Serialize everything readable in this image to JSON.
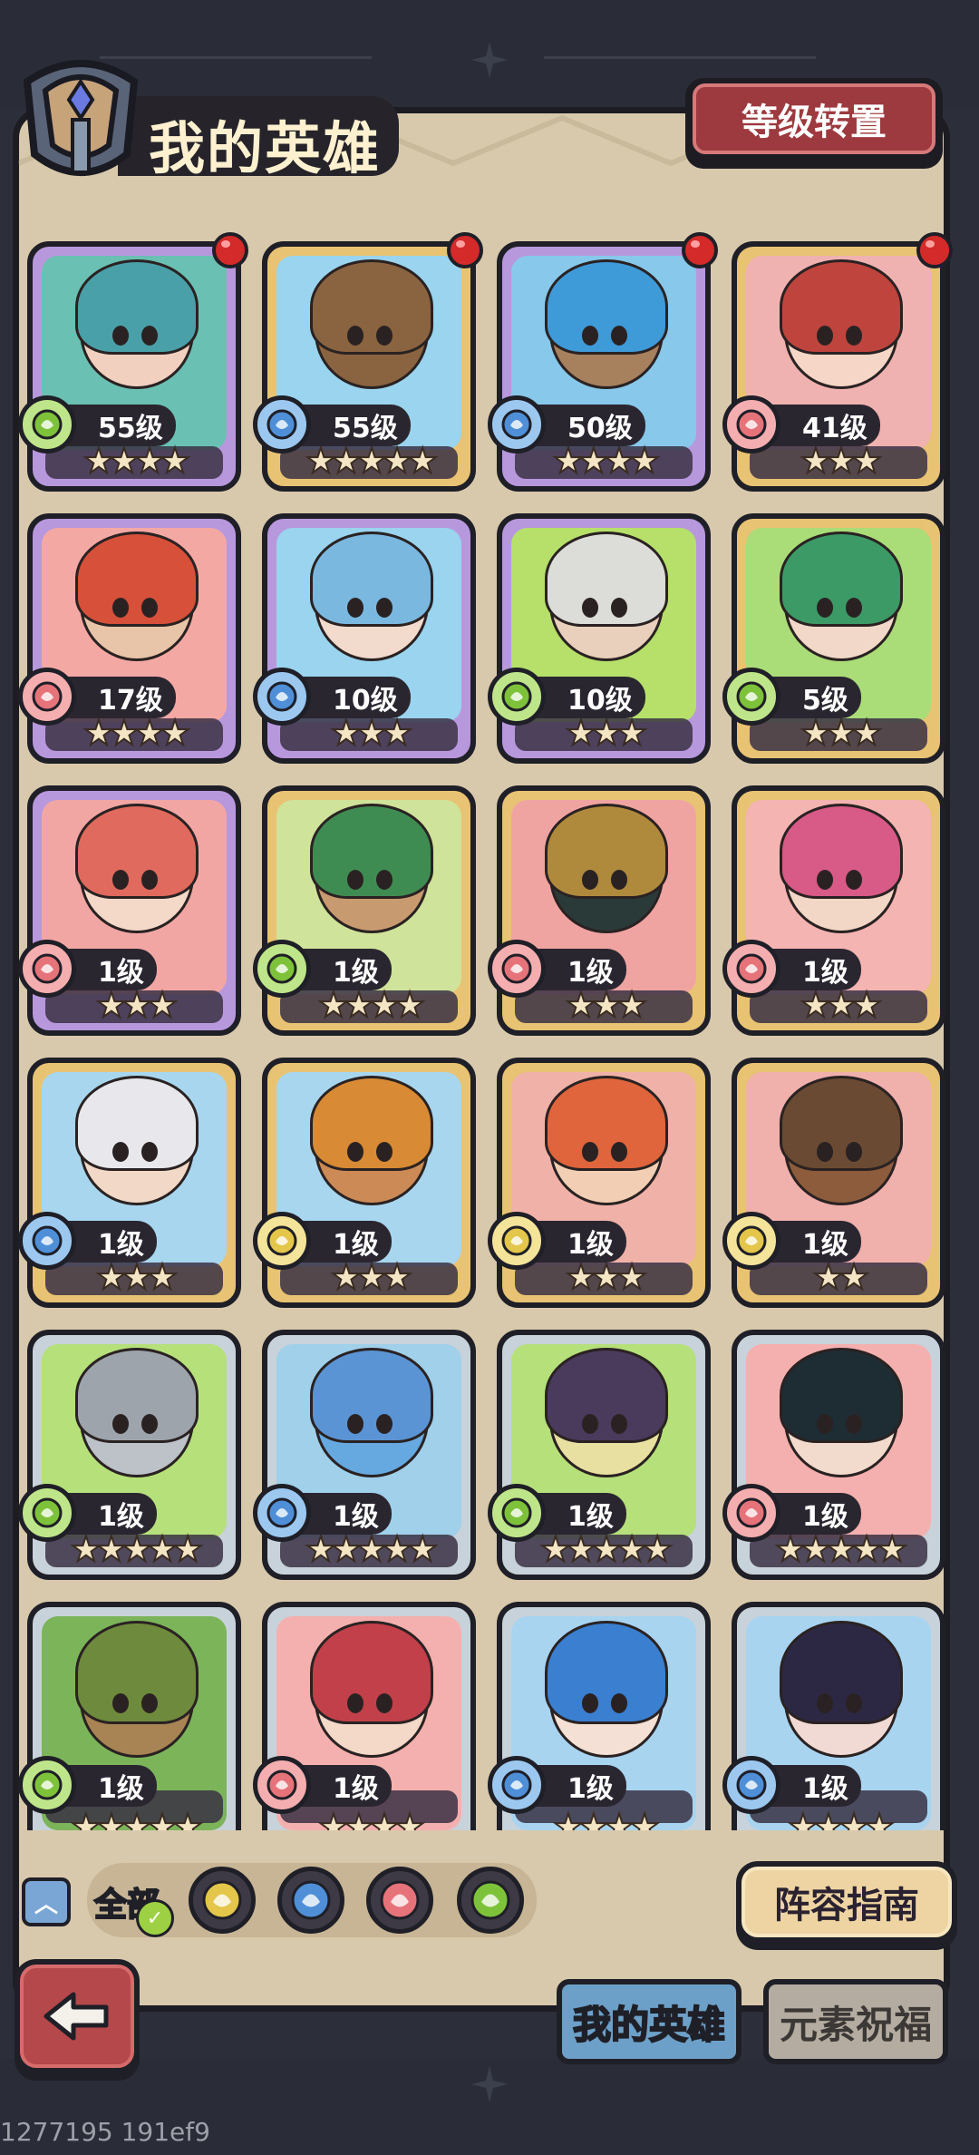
{
  "header": {
    "title": "我的英雄",
    "level_transfer_label": "等级转置"
  },
  "colors": {
    "fire": "#e66a72",
    "water": "#4a8fd6",
    "wind": "#7fc43a",
    "earth": "#e2c74a",
    "frame_purple": "#b898dd",
    "frame_gold": "#e8c373",
    "frame_silver": "#c8d2da"
  },
  "heroes": [
    {
      "level": "55级",
      "element": "wind-icon",
      "stars": "★★★★",
      "frame": "purple",
      "bg": "#6ac0b2",
      "hair": "#4aa0a8",
      "skin": "#f2d0c0",
      "dot": true
    },
    {
      "level": "55级",
      "element": "water-icon",
      "stars": "★★★★★",
      "frame": "gold",
      "bg": "#9ad4ee",
      "hair": "#8a6440",
      "skin": "#8a6440",
      "dot": true
    },
    {
      "level": "50级",
      "element": "water-icon",
      "stars": "★★★★",
      "frame": "purple",
      "bg": "#88c8ea",
      "hair": "#3f9ad8",
      "skin": "#a7805e",
      "dot": true
    },
    {
      "level": "41级",
      "element": "fire-icon",
      "stars": "★★★",
      "frame": "gold",
      "bg": "#f0b2b0",
      "hair": "#c0443e",
      "skin": "#f6d6c6",
      "dot": true
    },
    {
      "level": "17级",
      "element": "fire-icon",
      "stars": "★★★★",
      "frame": "purple",
      "bg": "#f4a8a4",
      "hair": "#d6503a",
      "skin": "#e8c4a8",
      "dot": false
    },
    {
      "level": "10级",
      "element": "water-icon",
      "stars": "★★★",
      "frame": "purple",
      "bg": "#9ad4ee",
      "hair": "#7ab8e0",
      "skin": "#f2dacc",
      "dot": false
    },
    {
      "level": "10级",
      "element": "wind-icon",
      "stars": "★★★",
      "frame": "purple",
      "bg": "#b6e06a",
      "hair": "#dcdcd8",
      "skin": "#e8d0bc",
      "dot": false
    },
    {
      "level": "5级",
      "element": "wind-icon",
      "stars": "★★★",
      "frame": "gold",
      "bg": "#aadc78",
      "hair": "#3c9a66",
      "skin": "#f2d8c8",
      "dot": false
    },
    {
      "level": "1级",
      "element": "fire-icon",
      "stars": "★★★",
      "frame": "purple",
      "bg": "#f2a6a4",
      "hair": "#e06a5e",
      "skin": "#f4d8c8",
      "dot": false
    },
    {
      "level": "1级",
      "element": "wind-icon",
      "stars": "★★★★",
      "frame": "gold",
      "bg": "#cfe39a",
      "hair": "#3f8c52",
      "skin": "#c89a70",
      "dot": false
    },
    {
      "level": "1级",
      "element": "fire-icon",
      "stars": "★★★",
      "frame": "gold",
      "bg": "#f0a4a2",
      "hair": "#b08a3c",
      "skin": "#2a3a38",
      "dot": false
    },
    {
      "level": "1级",
      "element": "fire-icon",
      "stars": "★★★",
      "frame": "gold",
      "bg": "#f4b4b2",
      "hair": "#d85a86",
      "skin": "#f2d6c6",
      "dot": false
    },
    {
      "level": "1级",
      "element": "water-icon",
      "stars": "★★★",
      "frame": "gold",
      "bg": "#a8d6ee",
      "hair": "#e8e8ec",
      "skin": "#f2d8c6",
      "dot": false
    },
    {
      "level": "1级",
      "element": "earth-icon",
      "stars": "★★★",
      "frame": "gold",
      "bg": "#a8d6ee",
      "hair": "#d88a34",
      "skin": "#cc8a56",
      "dot": false
    },
    {
      "level": "1级",
      "element": "earth-icon",
      "stars": "★★★",
      "frame": "gold",
      "bg": "#f0b2a8",
      "hair": "#e0653c",
      "skin": "#f2cfb4",
      "dot": false
    },
    {
      "level": "1级",
      "element": "earth-icon",
      "stars": "★★",
      "frame": "gold",
      "bg": "#f0b0ac",
      "hair": "#6a4a32",
      "skin": "#8c5c3c",
      "dot": false
    },
    {
      "level": "1级",
      "element": "wind-icon",
      "stars": "★★★★★",
      "frame": "silver",
      "bg": "#b6e07a",
      "hair": "#9ea4ac",
      "skin": "#bcc2c8",
      "dot": false
    },
    {
      "level": "1级",
      "element": "water-icon",
      "stars": "★★★★★",
      "frame": "silver",
      "bg": "#a0d0ea",
      "hair": "#5a94d4",
      "skin": "#66a8e0",
      "dot": false
    },
    {
      "level": "1级",
      "element": "wind-icon",
      "stars": "★★★★★",
      "frame": "silver",
      "bg": "#b6e07a",
      "hair": "#4a3a5c",
      "skin": "#e8e0a0",
      "dot": false
    },
    {
      "level": "1级",
      "element": "fire-icon",
      "stars": "★★★★★",
      "frame": "silver",
      "bg": "#f4b0ae",
      "hair": "#1e2c34",
      "skin": "#f2dacc",
      "dot": false
    },
    {
      "level": "1级",
      "element": "wind-icon",
      "stars": "★★★★★",
      "frame": "silver",
      "bg": "#7cb45a",
      "hair": "#6e8a3c",
      "skin": "#a88454",
      "dot": false
    },
    {
      "level": "1级",
      "element": "fire-icon",
      "stars": "★★★★",
      "frame": "silver",
      "bg": "#f4b0ae",
      "hair": "#c2404a",
      "skin": "#f4d8c8",
      "dot": false
    },
    {
      "level": "1级",
      "element": "water-icon",
      "stars": "★★★★",
      "frame": "silver",
      "bg": "#a8d4f0",
      "hair": "#3a7fd0",
      "skin": "#f4e0d4",
      "dot": false
    },
    {
      "level": "1级",
      "element": "water-icon",
      "stars": "★★★★",
      "frame": "silver",
      "bg": "#a8d4f0",
      "hair": "#2c2844",
      "skin": "#f2dad4",
      "dot": false
    }
  ],
  "filters": {
    "all_label": "全部",
    "elements": [
      "earth-icon",
      "water-icon",
      "fire-icon",
      "wind-icon"
    ]
  },
  "lineup_guide_label": "阵容指南",
  "tabs": [
    {
      "label": "我的英雄",
      "active": true
    },
    {
      "label": "元素祝福",
      "active": false
    }
  ],
  "debug_text": "1277195 191ef9"
}
